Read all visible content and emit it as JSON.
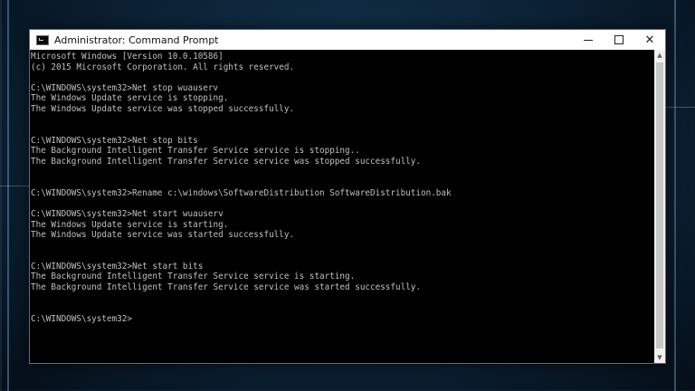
{
  "window": {
    "title": "Administrator: Command Prompt",
    "controls": {
      "minimize": "minimize",
      "maximize": "maximize",
      "close": "✕"
    }
  },
  "console": {
    "lines": [
      "Microsoft Windows [Version 10.0.10586]",
      "(c) 2015 Microsoft Corporation. All rights reserved.",
      "",
      "C:\\WINDOWS\\system32>Net stop wuauserv",
      "The Windows Update service is stopping.",
      "The Windows Update service was stopped successfully.",
      "",
      "",
      "C:\\WINDOWS\\system32>Net stop bits",
      "The Background Intelligent Transfer Service service is stopping..",
      "The Background Intelligent Transfer Service service was stopped successfully.",
      "",
      "",
      "C:\\WINDOWS\\system32>Rename c:\\windows\\SoftwareDistribution SoftwareDistribution.bak",
      "",
      "C:\\WINDOWS\\system32>Net start wuauserv",
      "The Windows Update service is starting.",
      "The Windows Update service was started successfully.",
      "",
      "",
      "C:\\WINDOWS\\system32>Net start bits",
      "The Background Intelligent Transfer Service service is starting.",
      "The Background Intelligent Transfer Service service was started successfully.",
      "",
      "",
      "C:\\WINDOWS\\system32>"
    ]
  },
  "colors": {
    "console_bg": "#000000",
    "console_text": "#c0c0c0",
    "titlebar_bg": "#ffffff",
    "desktop_accent": "#1c4466"
  }
}
